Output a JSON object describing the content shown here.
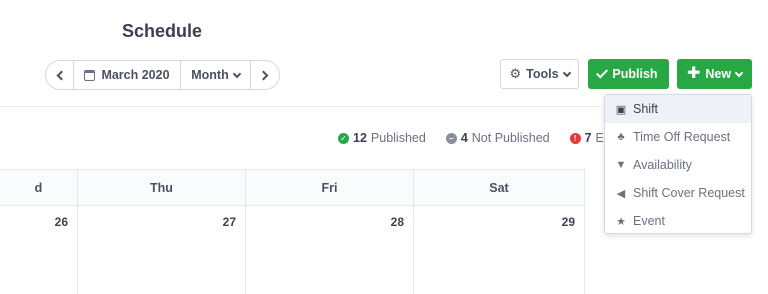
{
  "header": {
    "title": "Schedule"
  },
  "date_nav": {
    "month_label": "March 2020",
    "view_label": "Month"
  },
  "buttons": {
    "tools": "Tools",
    "publish": "Publish",
    "new": "New"
  },
  "status": {
    "published_count": "12",
    "published_label": "Published",
    "not_published_count": "4",
    "not_published_label": "Not Published",
    "errors_count": "7",
    "errors_label": "Err"
  },
  "calendar": {
    "days": [
      "d",
      "Thu",
      "Fri",
      "Sat"
    ],
    "dates": [
      "26",
      "27",
      "28",
      "29"
    ]
  },
  "new_menu": {
    "items": [
      {
        "label": "Shift",
        "icon": "calendar-icon"
      },
      {
        "label": "Time Off Request",
        "icon": "palm-tree-icon"
      },
      {
        "label": "Availability",
        "icon": "thumbs-down-icon"
      },
      {
        "label": "Shift Cover Request",
        "icon": "megaphone-icon"
      },
      {
        "label": "Event",
        "icon": "star-icon"
      }
    ]
  },
  "colors": {
    "accent_green": "#28a745",
    "error_red": "#e53935",
    "muted_gray": "#8a8f99"
  }
}
